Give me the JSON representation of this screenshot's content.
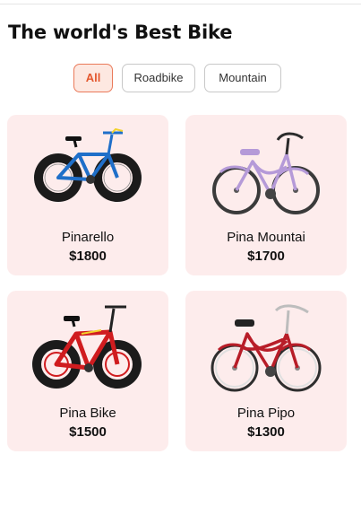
{
  "header": {
    "title": "The world's Best Bike"
  },
  "filters": [
    {
      "label": "All",
      "active": true
    },
    {
      "label": "Roadbike",
      "active": false
    },
    {
      "label": "Mountain",
      "active": false
    }
  ],
  "products": [
    {
      "name": "Pinarello",
      "price": "$1800",
      "image": "blue-fat-tire-bike-icon"
    },
    {
      "name": "Pina Mountai",
      "price": "$1700",
      "image": "lavender-cruiser-bike-icon"
    },
    {
      "name": "Pina Bike",
      "price": "$1500",
      "image": "red-fat-tire-bike-icon"
    },
    {
      "name": "Pina Pipo",
      "price": "$1300",
      "image": "red-cruiser-bike-icon"
    }
  ],
  "colors": {
    "accent": "#e4572e",
    "chip_active_bg": "#fde8e1",
    "card_bg": "#fdecec",
    "bike_blue": "#1f6fc9",
    "bike_lavender": "#b59ad8",
    "bike_red": "#d01c1f",
    "bike_crimson": "#b81d28"
  }
}
